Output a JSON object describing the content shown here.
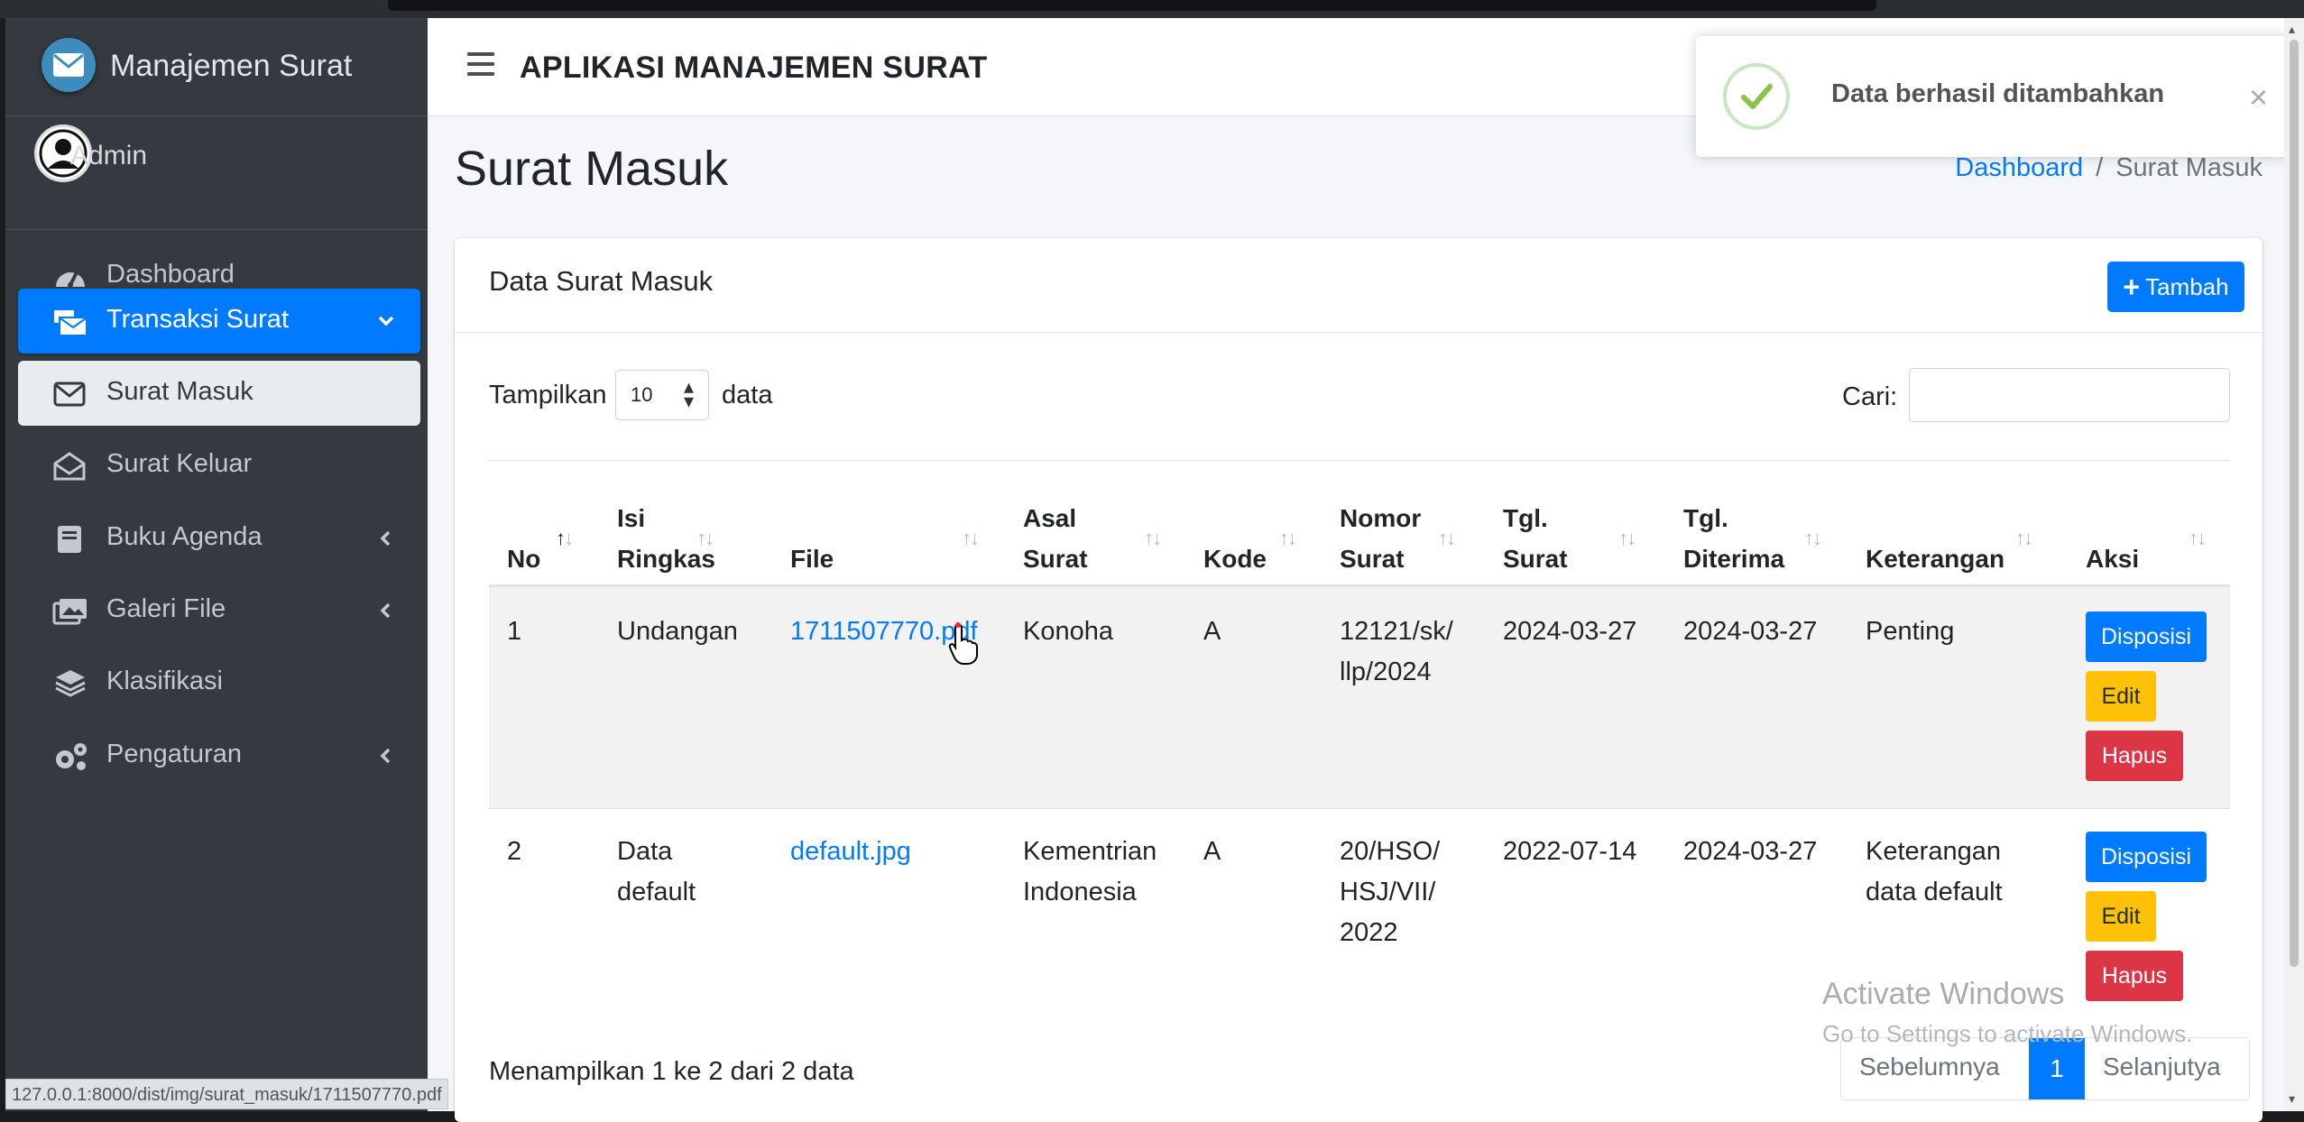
{
  "app": {
    "brand": "Manajemen Surat",
    "title": "APLIKASI MANAJEMEN SURAT",
    "user": "Admin"
  },
  "sidebar": {
    "items": [
      {
        "label": "Dashboard",
        "icon": "tachometer-icon"
      },
      {
        "label": "Transaksi Surat",
        "icon": "mail-bulk-icon",
        "active": true,
        "expanded": true
      },
      {
        "label": "Surat Masuk",
        "icon": "envelope-icon",
        "sub_active": true
      },
      {
        "label": "Surat Keluar",
        "icon": "envelope-open-icon"
      },
      {
        "label": "Buku Agenda",
        "icon": "book-icon"
      },
      {
        "label": "Galeri File",
        "icon": "images-icon"
      },
      {
        "label": "Klasifikasi",
        "icon": "layers-icon"
      },
      {
        "label": "Pengaturan",
        "icon": "cogs-icon"
      }
    ]
  },
  "page": {
    "title": "Surat Masuk"
  },
  "breadcrumb": {
    "home": "Dashboard",
    "sep": "/",
    "current": "Surat Masuk"
  },
  "card": {
    "title": "Data Surat Masuk",
    "add_button": "Tambah"
  },
  "table_controls": {
    "show_label": "Tampilkan",
    "show_value": "10",
    "show_suffix": "data",
    "search_label": "Cari:",
    "search_value": ""
  },
  "table": {
    "headers": [
      {
        "line1": "",
        "line2": "No"
      },
      {
        "line1": "Isi",
        "line2": "Ringkas"
      },
      {
        "line1": "",
        "line2": "File"
      },
      {
        "line1": "Asal",
        "line2": "Surat"
      },
      {
        "line1": "",
        "line2": "Kode"
      },
      {
        "line1": "Nomor",
        "line2": "Surat"
      },
      {
        "line1": "Tgl.",
        "line2": "Surat"
      },
      {
        "line1": "Tgl.",
        "line2": "Diterima"
      },
      {
        "line1": "",
        "line2": "Keterangan"
      },
      {
        "line1": "",
        "line2": "Aksi"
      }
    ],
    "sort_glyph": "↑↓",
    "rows": [
      {
        "no": "1",
        "isi": [
          "Undangan"
        ],
        "file": "1711507770.pdf",
        "asal": [
          "Konoha"
        ],
        "kode": "A",
        "nomor": [
          "12121/sk/",
          "llp/2024"
        ],
        "tgl_surat": "2024-03-27",
        "tgl_diterima": "2024-03-27",
        "keterangan": [
          "Penting"
        ]
      },
      {
        "no": "2",
        "isi": [
          "Data",
          "default"
        ],
        "file": "default.jpg",
        "asal": [
          "Kementrian",
          "Indonesia"
        ],
        "kode": "A",
        "nomor": [
          "20/HSO/",
          "HSJ/VII/",
          "2022"
        ],
        "tgl_surat": "2022-07-14",
        "tgl_diterima": "2024-03-27",
        "keterangan": [
          "Keterangan",
          "data default"
        ]
      }
    ],
    "actions": {
      "disposisi": "Disposisi",
      "edit": "Edit",
      "hapus": "Hapus"
    }
  },
  "footer": {
    "info": "Menampilkan 1 ke 2 dari 2 data",
    "pagination": {
      "prev": "Sebelumnya",
      "current": "1",
      "next": "Selanjutya"
    }
  },
  "toast": {
    "message": "Data berhasil ditambahkan",
    "close": "×"
  },
  "status_url": "127.0.0.1:8000/dist/img/surat_masuk/1711507770.pdf",
  "watermark": {
    "line1": "Activate Windows",
    "line2": "Go to Settings to activate Windows."
  },
  "colors": {
    "primary": "#007bff",
    "warning": "#ffc107",
    "danger": "#dc3545",
    "sidebar": "#343a40",
    "success": "#8bc34a"
  }
}
